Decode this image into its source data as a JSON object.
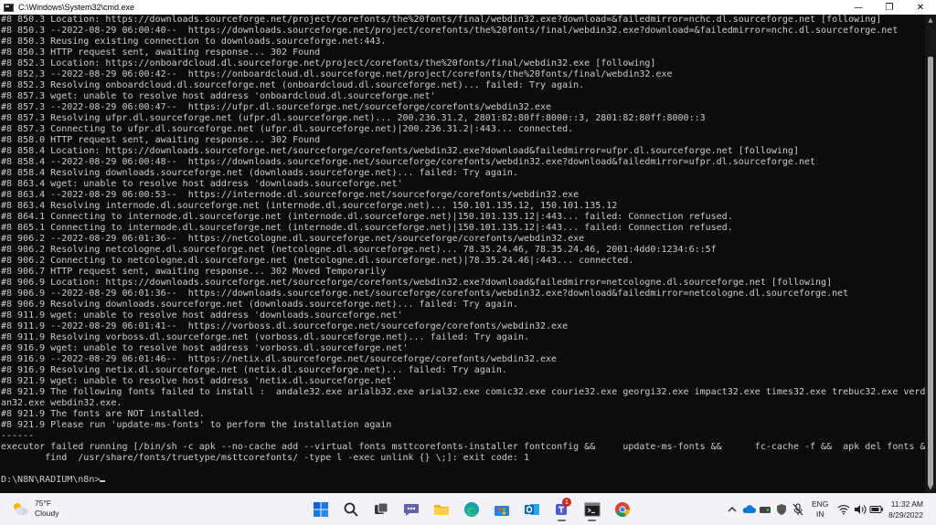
{
  "window": {
    "title": "C:\\Windows\\System32\\cmd.exe",
    "controls": {
      "minimize": "—",
      "maximize": "❐",
      "close": "✕"
    }
  },
  "console": {
    "lines": [
      "#8 850.3 Location: https://downloads.sourceforge.net/project/corefonts/the%20fonts/final/webdin32.exe?download=&failedmirror=nchc.dl.sourceforge.net [following]",
      "#8 850.3 --2022-08-29 06:00:40--  https://downloads.sourceforge.net/project/corefonts/the%20fonts/final/webdin32.exe?download=&failedmirror=nchc.dl.sourceforge.net",
      "#8 850.3 Reusing existing connection to downloads.sourceforge.net:443.",
      "#8 850.3 HTTP request sent, awaiting response... 302 Found",
      "#8 852.3 Location: https://onboardcloud.dl.sourceforge.net/project/corefonts/the%20fonts/final/webdin32.exe [following]",
      "#8 852.3 --2022-08-29 06:00:42--  https://onboardcloud.dl.sourceforge.net/project/corefonts/the%20fonts/final/webdin32.exe",
      "#8 852.3 Resolving onboardcloud.dl.sourceforge.net (onboardcloud.dl.sourceforge.net)... failed: Try again.",
      "#8 857.3 wget: unable to resolve host address 'onboardcloud.dl.sourceforge.net'",
      "#8 857.3 --2022-08-29 06:00:47--  https://ufpr.dl.sourceforge.net/sourceforge/corefonts/webdin32.exe",
      "#8 857.3 Resolving ufpr.dl.sourceforge.net (ufpr.dl.sourceforge.net)... 200.236.31.2, 2801:82:80ff:8000::3, 2801:82:80ff:8000::3",
      "#8 857.3 Connecting to ufpr.dl.sourceforge.net (ufpr.dl.sourceforge.net)|200.236.31.2|:443... connected.",
      "#8 858.0 HTTP request sent, awaiting response... 302 Found",
      "#8 858.4 Location: https://downloads.sourceforge.net/sourceforge/corefonts/webdin32.exe?download&failedmirror=ufpr.dl.sourceforge.net [following]",
      "#8 858.4 --2022-08-29 06:00:48--  https://downloads.sourceforge.net/sourceforge/corefonts/webdin32.exe?download&failedmirror=ufpr.dl.sourceforge.net",
      "#8 858.4 Resolving downloads.sourceforge.net (downloads.sourceforge.net)... failed: Try again.",
      "#8 863.4 wget: unable to resolve host address 'downloads.sourceforge.net'",
      "#8 863.4 --2022-08-29 06:00:53--  https://internode.dl.sourceforge.net/sourceforge/corefonts/webdin32.exe",
      "#8 863.4 Resolving internode.dl.sourceforge.net (internode.dl.sourceforge.net)... 150.101.135.12, 150.101.135.12",
      "#8 864.1 Connecting to internode.dl.sourceforge.net (internode.dl.sourceforge.net)|150.101.135.12|:443... failed: Connection refused.",
      "#8 865.1 Connecting to internode.dl.sourceforge.net (internode.dl.sourceforge.net)|150.101.135.12|:443... failed: Connection refused.",
      "#8 906.2 --2022-08-29 06:01:36--  https://netcologne.dl.sourceforge.net/sourceforge/corefonts/webdin32.exe",
      "#8 906.2 Resolving netcologne.dl.sourceforge.net (netcologne.dl.sourceforge.net)... 78.35.24.46, 78.35.24.46, 2001:4dd0:1234:6::5f",
      "#8 906.2 Connecting to netcologne.dl.sourceforge.net (netcologne.dl.sourceforge.net)|78.35.24.46|:443... connected.",
      "#8 906.7 HTTP request sent, awaiting response... 302 Moved Temporarily",
      "#8 906.9 Location: https://downloads.sourceforge.net/sourceforge/corefonts/webdin32.exe?download&failedmirror=netcologne.dl.sourceforge.net [following]",
      "#8 906.9 --2022-08-29 06:01:36--  https://downloads.sourceforge.net/sourceforge/corefonts/webdin32.exe?download&failedmirror=netcologne.dl.sourceforge.net",
      "#8 906.9 Resolving downloads.sourceforge.net (downloads.sourceforge.net)... failed: Try again.",
      "#8 911.9 wget: unable to resolve host address 'downloads.sourceforge.net'",
      "#8 911.9 --2022-08-29 06:01:41--  https://vorboss.dl.sourceforge.net/sourceforge/corefonts/webdin32.exe",
      "#8 911.9 Resolving vorboss.dl.sourceforge.net (vorboss.dl.sourceforge.net)... failed: Try again.",
      "#8 916.9 wget: unable to resolve host address 'vorboss.dl.sourceforge.net'",
      "#8 916.9 --2022-08-29 06:01:46--  https://netix.dl.sourceforge.net/sourceforge/corefonts/webdin32.exe",
      "#8 916.9 Resolving netix.dl.sourceforge.net (netix.dl.sourceforge.net)... failed: Try again.",
      "#8 921.9 wget: unable to resolve host address 'netix.dl.sourceforge.net'",
      "#8 921.9 The following fonts failed to install :  andale32.exe arialb32.exe arial32.exe comic32.exe courie32.exe georgi32.exe impact32.exe times32.exe trebuc32.exe verd",
      "an32.exe webdin32.exe.",
      "#8 921.9 The fonts are NOT installed.",
      "#8 921.9 Please run 'update-ms-fonts' to perform the installation again",
      "------",
      "executor failed running [/bin/sh -c apk --no-cache add --virtual fonts msttcorefonts-installer fontconfig &&     update-ms-fonts &&      fc-cache -f &&  apk del fonts &&",
      "        find  /usr/share/fonts/truetype/msttcorefonts/ -type l -exec unlink {} \\;]: exit code: 1",
      "",
      "D:\\N8N\\RADIUM\\n8n>"
    ]
  },
  "taskbar": {
    "weather": {
      "temp": "75°F",
      "condition": "Cloudy"
    },
    "language": {
      "line1": "ENG",
      "line2": "IN"
    },
    "clock": {
      "time": "11:32 AM",
      "date": "8/29/2022"
    },
    "teams_badge": "1"
  }
}
